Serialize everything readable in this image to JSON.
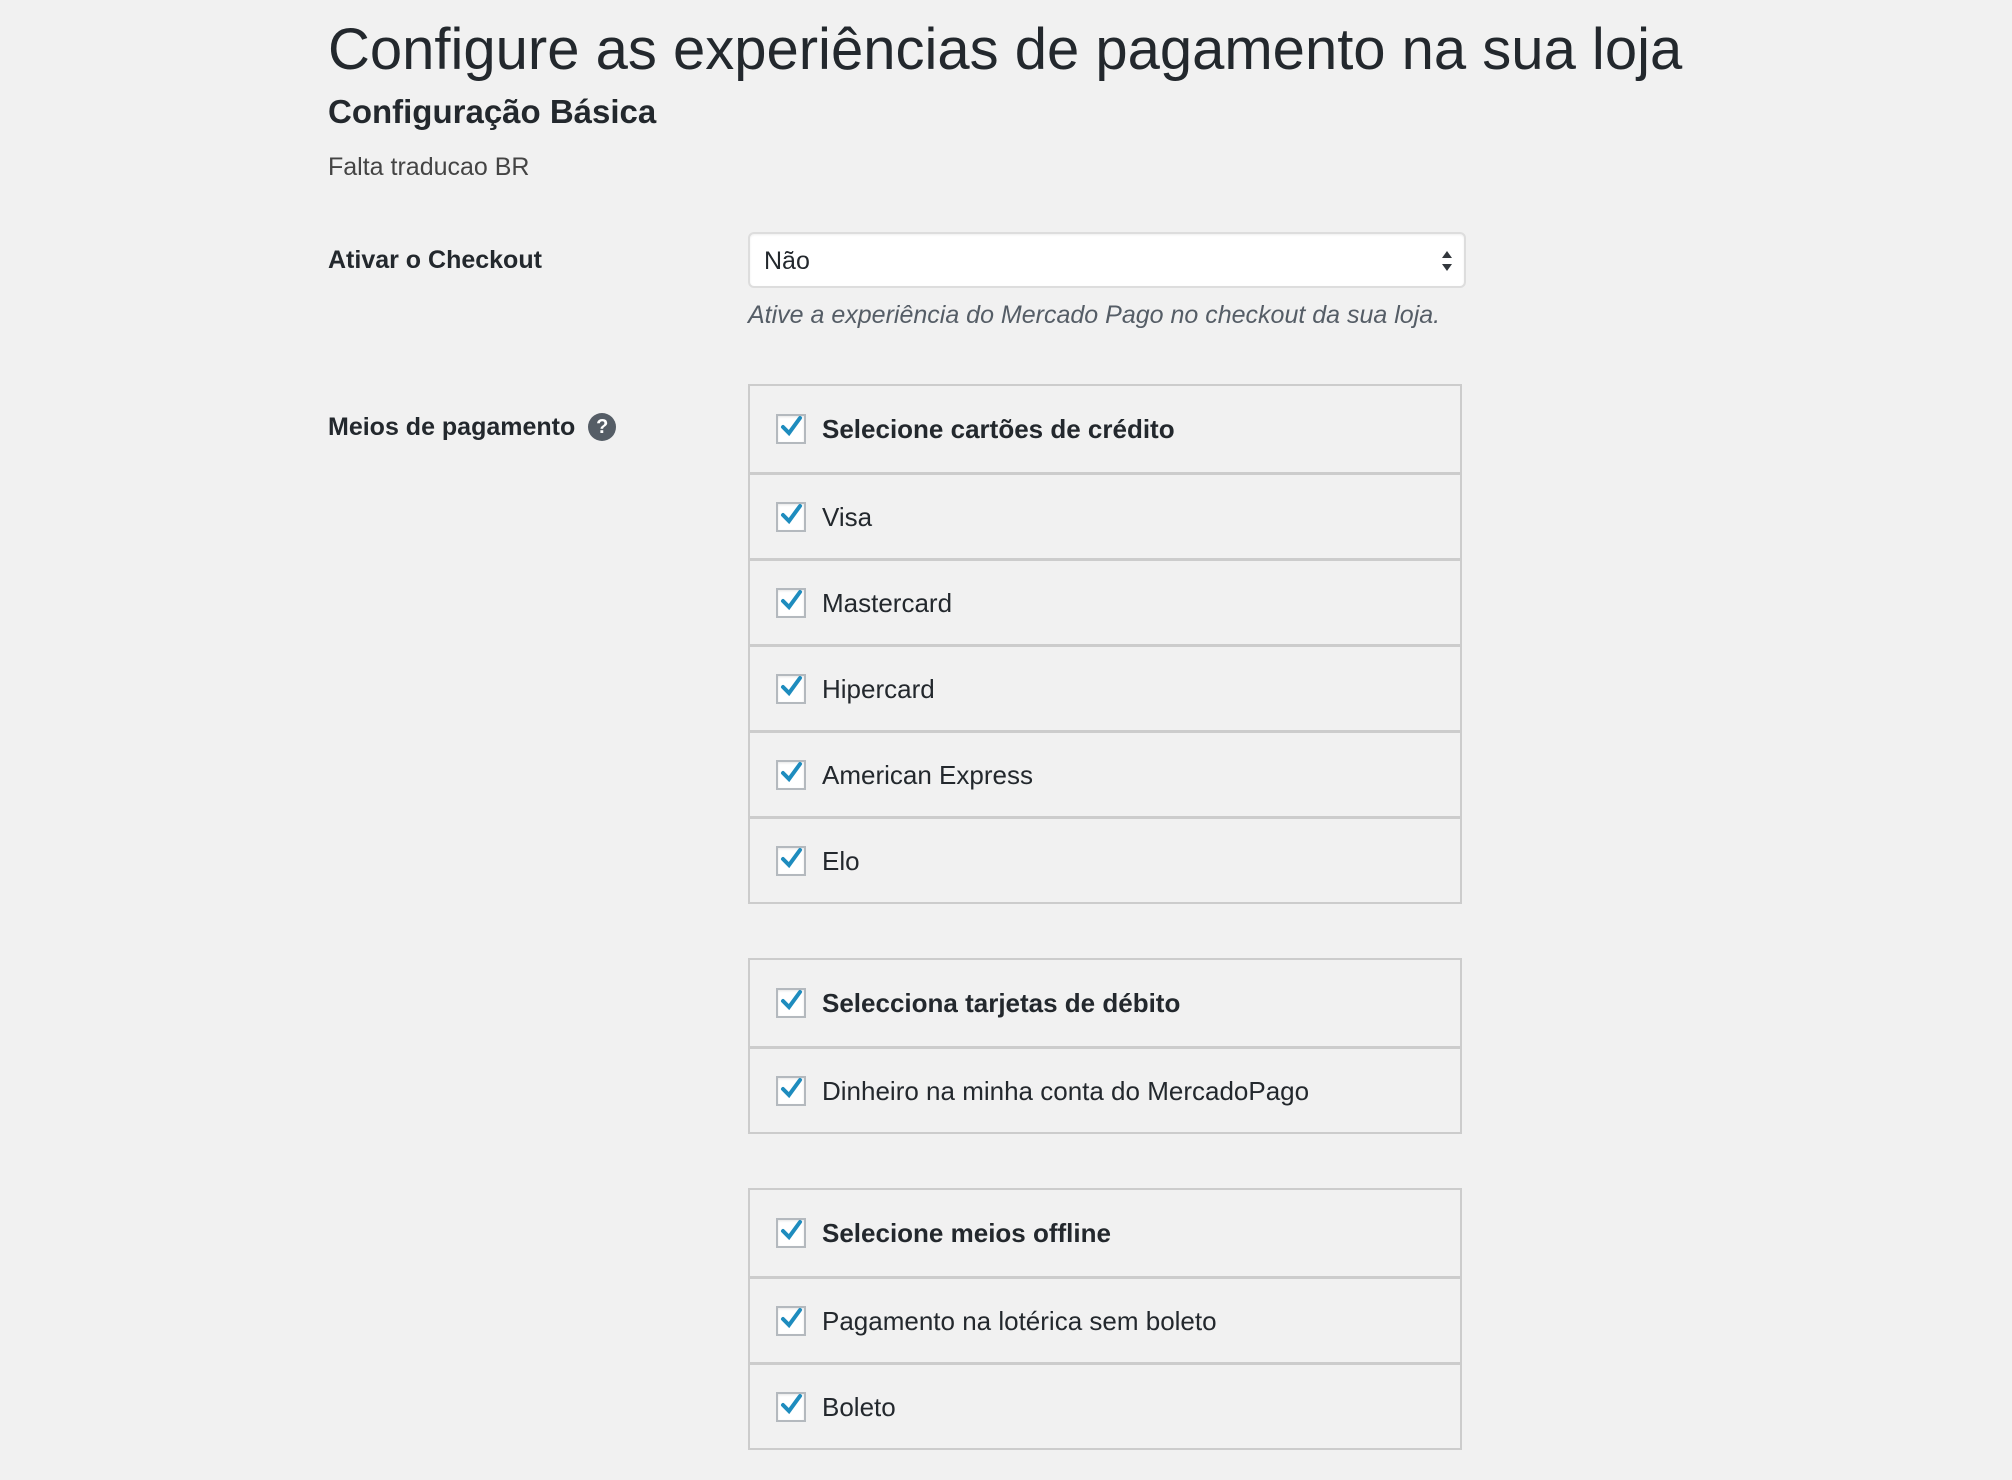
{
  "page": {
    "title": "Configure as experiências de pagamento na sua loja"
  },
  "basic_section": {
    "title": "Configuração Básica",
    "description": "Falta traducao BR"
  },
  "checkout_field": {
    "label": "Ativar o Checkout",
    "selected_value": "Não",
    "description": "Ative a experiência do Mercado Pago no checkout da sua loja."
  },
  "payment_methods": {
    "label": "Meios de pagamento",
    "help_icon": "question-circle-icon",
    "help_glyph": "?",
    "groups": [
      {
        "header": {
          "label": "Selecione cartões de crédito",
          "checked": true
        },
        "items": [
          {
            "label": "Visa",
            "checked": true
          },
          {
            "label": "Mastercard",
            "checked": true
          },
          {
            "label": "Hipercard",
            "checked": true
          },
          {
            "label": "American Express",
            "checked": true
          },
          {
            "label": "Elo",
            "checked": true
          }
        ]
      },
      {
        "header": {
          "label": "Selecciona tarjetas de débito",
          "checked": true
        },
        "items": [
          {
            "label": "Dinheiro na minha conta do MercadoPago",
            "checked": true
          }
        ]
      },
      {
        "header": {
          "label": "Selecione meios offline",
          "checked": true
        },
        "items": [
          {
            "label": "Pagamento na lotérica sem boleto",
            "checked": true
          },
          {
            "label": "Boleto",
            "checked": true
          }
        ]
      }
    ]
  },
  "colors": {
    "background": "#f1f1f1",
    "checkmark": "#1e8cbe",
    "border": "#cccccc"
  }
}
